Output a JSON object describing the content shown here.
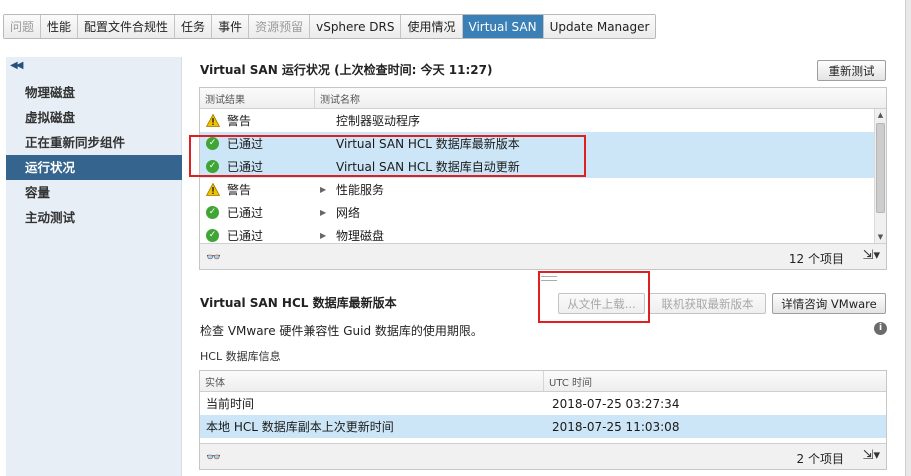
{
  "tabs": [
    {
      "label": "问题",
      "state": "disabled"
    },
    {
      "label": "性能",
      "state": "normal"
    },
    {
      "label": "配置文件合规性",
      "state": "normal"
    },
    {
      "label": "任务",
      "state": "normal"
    },
    {
      "label": "事件",
      "state": "normal"
    },
    {
      "label": "资源预留",
      "state": "disabled"
    },
    {
      "label": "vSphere DRS",
      "state": "normal"
    },
    {
      "label": "使用情况",
      "state": "normal"
    },
    {
      "label": "Virtual SAN",
      "state": "active"
    },
    {
      "label": "Update Manager",
      "state": "normal"
    }
  ],
  "sidebar": {
    "collapse_icon": "double-chevron-left-icon",
    "items": [
      {
        "label": "物理磁盘"
      },
      {
        "label": "虚拟磁盘"
      },
      {
        "label": "正在重新同步组件"
      },
      {
        "label": "运行状况",
        "selected": true
      },
      {
        "label": "容量"
      },
      {
        "label": "主动测试"
      }
    ]
  },
  "health": {
    "title": "Virtual SAN 运行状况 (上次检查时间: 今天 11:27)",
    "retest_button": "重新测试",
    "columns": [
      "测试结果",
      "测试名称"
    ],
    "rows": [
      {
        "status": "警告",
        "status_icon": "warning-icon",
        "name": "控制器驱动程序",
        "expandable": false
      },
      {
        "status": "已通过",
        "status_icon": "passed-icon",
        "name": "Virtual SAN HCL 数据库最新版本",
        "expandable": false,
        "selected": true
      },
      {
        "status": "已通过",
        "status_icon": "passed-icon",
        "name": "Virtual SAN HCL 数据库自动更新",
        "expandable": false,
        "selected": true
      },
      {
        "status": "警告",
        "status_icon": "warning-icon",
        "name": "性能服务",
        "expandable": true
      },
      {
        "status": "已通过",
        "status_icon": "passed-icon",
        "name": "网络",
        "expandable": true
      },
      {
        "status": "已通过",
        "status_icon": "passed-icon",
        "name": "物理磁盘",
        "expandable": true
      }
    ],
    "item_count": "12 个项目"
  },
  "hcl": {
    "title": "Virtual SAN HCL 数据库最新版本",
    "upload_button": "从文件上载...",
    "online_button": "联机获取最新版本",
    "ask_button": "详情咨询 VMware",
    "description": "检查 VMware 硬件兼容性 Guid 数据库的使用期限。",
    "info_label": "HCL 数据库信息",
    "columns": [
      "实体",
      "UTC 时间"
    ],
    "rows": [
      {
        "entity": "当前时间",
        "time": "2018-07-25 03:27:34"
      },
      {
        "entity": "本地 HCL 数据库副本上次更新时间",
        "time": "2018-07-25 11:03:08",
        "selected": true
      }
    ],
    "item_count": "2 个项目"
  },
  "colors": {
    "active_tab": "#3a7fb5",
    "selected_nav": "#35648e",
    "selected_row": "#cce6f7",
    "highlight_box": "#e02020",
    "passed": "#3fa535",
    "warning": "#f2c200"
  }
}
